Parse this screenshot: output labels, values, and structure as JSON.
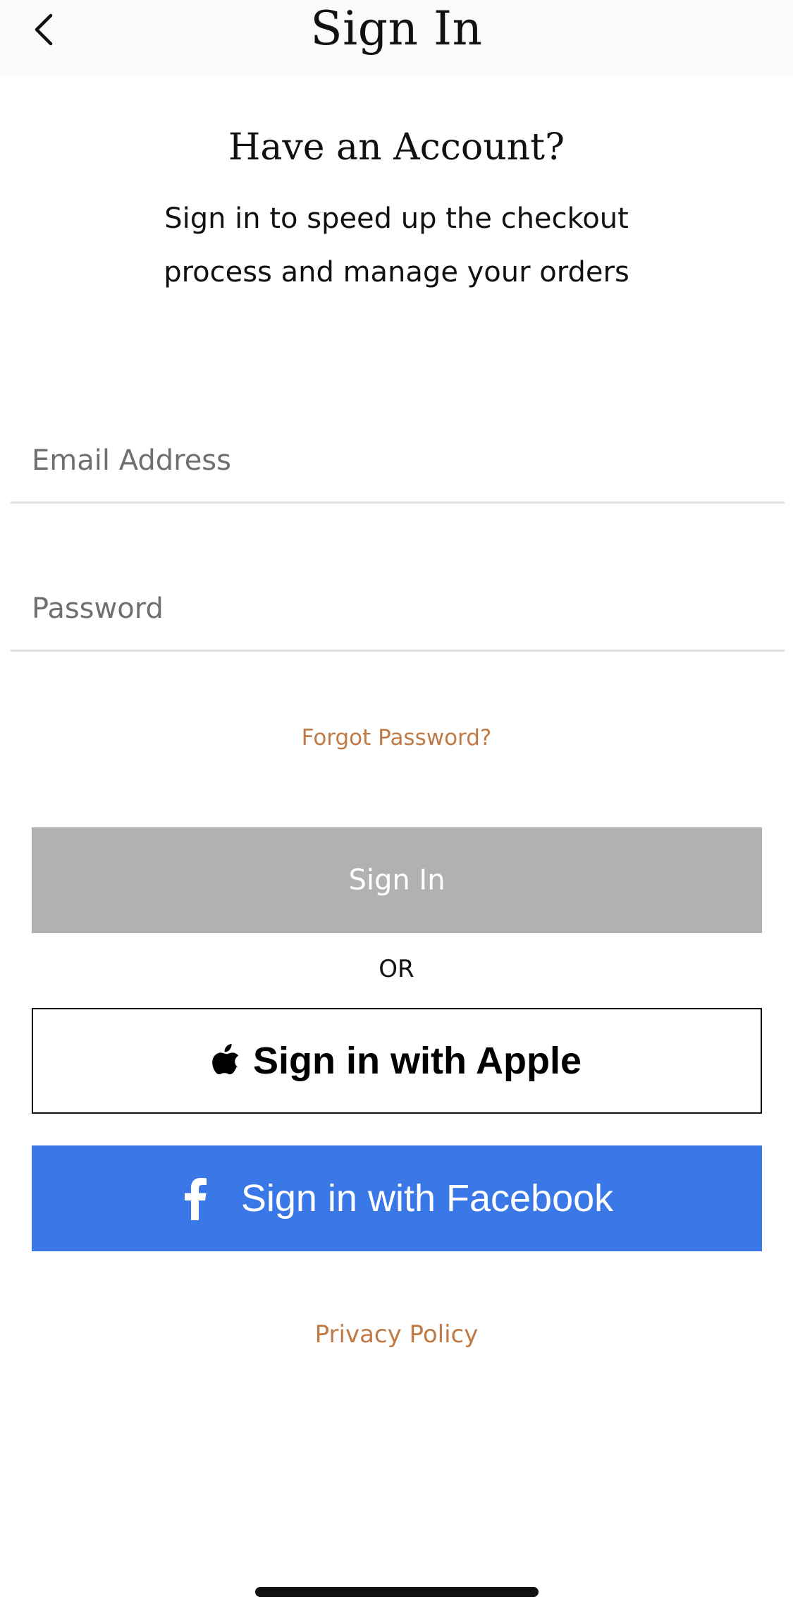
{
  "nav": {
    "title": "Sign In",
    "back_icon": "chevron-left-icon"
  },
  "intro": {
    "heading": "Have an Account?",
    "line1": "Sign in to speed up the checkout",
    "line2": "process and manage your orders"
  },
  "form": {
    "email_placeholder": "Email Address",
    "email_value": "",
    "password_placeholder": "Password",
    "password_value": "",
    "forgot_password": "Forgot Password?",
    "sign_in_label": "Sign In",
    "or_label": "OR"
  },
  "social": {
    "apple_label": "Sign in with Apple",
    "apple_icon": "apple-icon",
    "facebook_label": "Sign in with Facebook",
    "facebook_icon": "facebook-icon"
  },
  "footer": {
    "privacy_policy": "Privacy Policy"
  },
  "colors": {
    "link": "#c07a45",
    "sign_in_disabled": "#b1b1b1",
    "facebook": "#3b78e7",
    "nav_background": "#fafafa"
  }
}
